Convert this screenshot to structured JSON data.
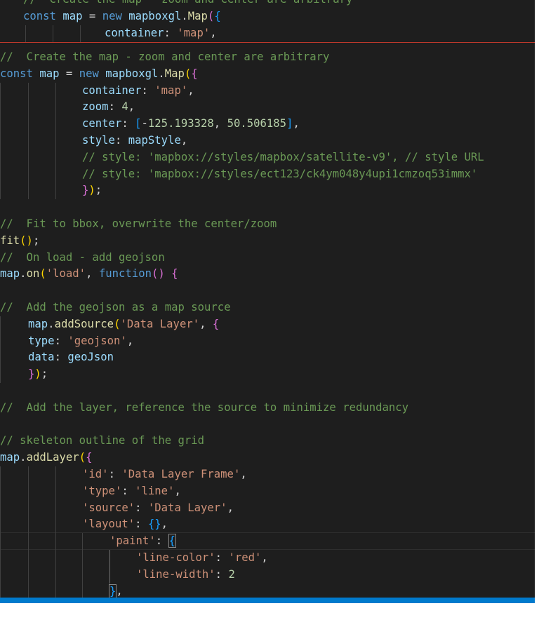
{
  "sticky": [
    [
      "c",
      "//  Create the map - zoom and center are arbitrary"
    ],
    [
      [
        "k",
        "const "
      ],
      [
        "v",
        "map"
      ],
      [
        "p",
        " = "
      ],
      [
        "k",
        "new "
      ],
      [
        "v",
        "mapboxgl"
      ],
      [
        "p",
        "."
      ],
      [
        "f",
        "Map"
      ],
      [
        "b2",
        "("
      ],
      [
        "b3",
        "{"
      ]
    ],
    [
      [
        "v",
        "container"
      ],
      [
        "p",
        ": "
      ],
      [
        "s",
        "'map'"
      ],
      [
        "p",
        ","
      ]
    ]
  ],
  "lines": [
    [
      "c",
      "//  Create the map - zoom and center are arbitrary"
    ],
    [
      [
        "k",
        "const "
      ],
      [
        "v",
        "map"
      ],
      [
        "p",
        " = "
      ],
      [
        "k",
        "new "
      ],
      [
        "v",
        "mapboxgl"
      ],
      [
        "p",
        "."
      ],
      [
        "f",
        "Map"
      ],
      [
        "b1",
        "("
      ],
      [
        "b2",
        "{"
      ]
    ],
    [
      [
        "v",
        "container"
      ],
      [
        "p",
        ": "
      ],
      [
        "s",
        "'map'"
      ],
      [
        "p",
        ","
      ]
    ],
    [
      [
        "v",
        "zoom"
      ],
      [
        "p",
        ": "
      ],
      [
        "n",
        "4"
      ],
      [
        "p",
        ","
      ]
    ],
    [
      [
        "v",
        "center"
      ],
      [
        "p",
        ": "
      ],
      [
        "b3",
        "["
      ],
      [
        "p",
        "-"
      ],
      [
        "n",
        "125.193328"
      ],
      [
        "p",
        ", "
      ],
      [
        "n",
        "50.506185"
      ],
      [
        "b3",
        "]"
      ],
      [
        "p",
        ","
      ]
    ],
    [
      [
        "v",
        "style"
      ],
      [
        "p",
        ": "
      ],
      [
        "v",
        "mapStyle"
      ],
      [
        "p",
        ","
      ]
    ],
    [
      "c",
      "// style: 'mapbox://styles/mapbox/satellite-v9', // style URL"
    ],
    [
      "c",
      "// style: 'mapbox://styles/ect123/ck4ym048y4upi1cmzoq53immx'"
    ],
    [
      [
        "b2",
        "}"
      ],
      [
        "b1",
        ")"
      ],
      [
        "p",
        ";"
      ]
    ],
    [],
    [
      "c",
      "//  Fit to bbox, overwrite the center/zoom"
    ],
    [
      [
        "f",
        "fit"
      ],
      [
        "b1",
        "()"
      ],
      [
        "p",
        ";"
      ]
    ],
    [
      "c",
      "//  On load - add geojson"
    ],
    [
      [
        "v",
        "map"
      ],
      [
        "p",
        "."
      ],
      [
        "f",
        "on"
      ],
      [
        "b1",
        "("
      ],
      [
        "s",
        "'load'"
      ],
      [
        "p",
        ", "
      ],
      [
        "k",
        "function"
      ],
      [
        "b2",
        "()"
      ],
      [
        "p",
        " "
      ],
      [
        "b2",
        "{"
      ]
    ],
    [],
    [
      "c",
      "//  Add the geojson as a map source"
    ],
    [
      [
        "v",
        "map"
      ],
      [
        "p",
        "."
      ],
      [
        "f",
        "addSource"
      ],
      [
        "b1",
        "("
      ],
      [
        "s",
        "'Data Layer'"
      ],
      [
        "p",
        ", "
      ],
      [
        "b2",
        "{"
      ]
    ],
    [
      [
        "v",
        "type"
      ],
      [
        "p",
        ": "
      ],
      [
        "s",
        "'geojson'"
      ],
      [
        "p",
        ","
      ]
    ],
    [
      [
        "v",
        "data"
      ],
      [
        "p",
        ": "
      ],
      [
        "v",
        "geoJson"
      ]
    ],
    [
      [
        "b2",
        "}"
      ],
      [
        "b1",
        ")"
      ],
      [
        "p",
        ";"
      ]
    ],
    [],
    [
      "c",
      "//  Add the layer, reference the source to minimize redundancy"
    ],
    [],
    [
      "c",
      "// skeleton outline of the grid"
    ],
    [
      [
        "v",
        "map"
      ],
      [
        "p",
        "."
      ],
      [
        "f",
        "addLayer"
      ],
      [
        "b1",
        "("
      ],
      [
        "b2",
        "{"
      ]
    ],
    [
      [
        "s",
        "'id'"
      ],
      [
        "p",
        ": "
      ],
      [
        "s",
        "'Data Layer Frame'"
      ],
      [
        "p",
        ","
      ]
    ],
    [
      [
        "s",
        "'type'"
      ],
      [
        "p",
        ": "
      ],
      [
        "s",
        "'line'"
      ],
      [
        "p",
        ","
      ]
    ],
    [
      [
        "s",
        "'source'"
      ],
      [
        "p",
        ": "
      ],
      [
        "s",
        "'Data Layer'"
      ],
      [
        "p",
        ","
      ]
    ],
    [
      [
        "s",
        "'layout'"
      ],
      [
        "p",
        ": "
      ],
      [
        "b3",
        "{}"
      ],
      [
        "p",
        ","
      ]
    ],
    [
      [
        "s",
        "'paint'"
      ],
      [
        "p",
        ": "
      ],
      [
        "b3m",
        "{"
      ]
    ],
    [
      [
        "s",
        "'line-color'"
      ],
      [
        "p",
        ": "
      ],
      [
        "s",
        "'red'"
      ],
      [
        "p",
        ","
      ]
    ],
    [
      [
        "s",
        "'line-width'"
      ],
      [
        "p",
        ": "
      ],
      [
        "n",
        "2"
      ]
    ],
    [
      [
        "b3m",
        "}"
      ],
      [
        "p",
        ","
      ]
    ]
  ]
}
